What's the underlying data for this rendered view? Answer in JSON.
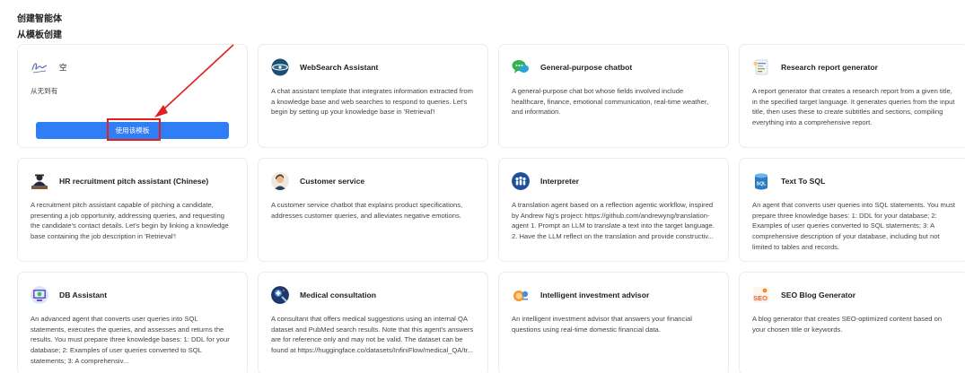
{
  "page": {
    "title": "创建智能体",
    "section_title": "从模板创建"
  },
  "empty_template": {
    "title": "空",
    "description": "从无到有",
    "button_label": "使用该模板"
  },
  "templates": [
    {
      "title": "WebSearch Assistant",
      "icon": "globe-icon",
      "description": "A chat assistant template that integrates information extracted from a knowledge base and web searches to respond to queries. Let's begin by setting up your knowledge base in 'Retrieval'!"
    },
    {
      "title": "General-purpose chatbot",
      "icon": "chat-bubbles-icon",
      "description": "A general-purpose chat bot whose fields involved include healthcare, finance, emotional communication, real-time weather, and information."
    },
    {
      "title": "Research report generator",
      "icon": "report-icon",
      "description": "A report generator that creates a research report from a given title, in the specified target language. It generates queries from the input title, then uses these to create subtitles and sections, compiling everything into a comprehensive report."
    },
    {
      "title": "HR recruitment pitch assistant (Chinese)",
      "icon": "recruiter-icon",
      "description": "A recruitment pitch assistant capable of pitching a candidate, presenting a job opportunity, addressing queries, and requesting the candidate's contact details. Let's begin by linking a knowledge base containing the job description in 'Retrieval'!"
    },
    {
      "title": "Customer service",
      "icon": "customer-service-icon",
      "description": "A customer service chatbot that explains product specifications, addresses customer queries, and alleviates negative emotions."
    },
    {
      "title": "Interpreter",
      "icon": "interpreter-icon",
      "description": "A translation agent based on a reflection agentic workflow, inspired by Andrew Ng's project: https://github.com/andrewyng/translation-agent 1. Prompt an LLM to translate a text into the target language. 2. Have the LLM reflect on the translation and provide constructiv..."
    },
    {
      "title": "Text To SQL",
      "icon": "sql-icon",
      "description": "An agent that converts user queries into SQL statements. You must prepare three knowledge bases: 1: DDL for your database; 2: Examples of user queries converted to SQL statements; 3: A comprehensive description of your database, including but not limited to tables and records."
    },
    {
      "title": "DB Assistant",
      "icon": "db-assistant-icon",
      "description": "An advanced agent that converts user queries into SQL statements, executes the queries, and assesses and returns the results. You must prepare three knowledge bases: 1: DDL for your database; 2: Examples of user queries converted to SQL statements; 3: A comprehensiv..."
    },
    {
      "title": "Medical consultation",
      "icon": "medical-icon",
      "description": "A consultant that offers medical suggestions using an internal QA dataset and PubMed search results. Note that this agent's answers are for reference only and may not be valid. The dataset can be found at https://huggingface.co/datasets/InfiniFlow/medical_QA/tr..."
    },
    {
      "title": "Intelligent investment advisor",
      "icon": "investment-icon",
      "description": "An intelligent investment advisor that answers your financial questions using real-time domestic financial data."
    },
    {
      "title": "SEO Blog Generator",
      "icon": "seo-icon",
      "description": "A blog generator that creates SEO-optimized content based on your chosen title or keywords."
    }
  ]
}
